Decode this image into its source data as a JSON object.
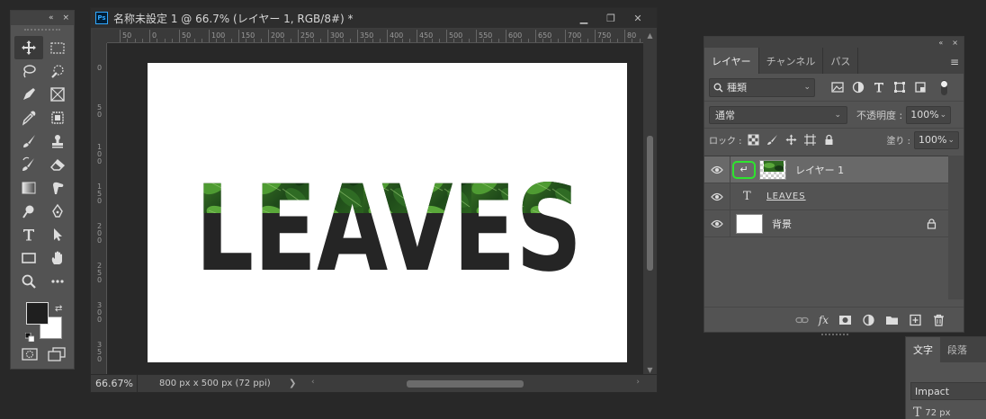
{
  "tools_panel": {
    "collapse": "«",
    "close": "×",
    "tools": [
      {
        "name": "move-tool-icon"
      },
      {
        "name": "marquee-tool-icon"
      },
      {
        "name": "lasso-tool-icon"
      },
      {
        "name": "quick-select-tool-icon"
      },
      {
        "name": "pen-tool-icon"
      },
      {
        "name": "frame-tool-icon"
      },
      {
        "name": "eyedropper-tool-icon"
      },
      {
        "name": "patch-tool-icon"
      },
      {
        "name": "brush-tool-icon"
      },
      {
        "name": "stamp-tool-icon"
      },
      {
        "name": "history-brush-tool-icon"
      },
      {
        "name": "eraser-tool-icon"
      },
      {
        "name": "gradient-tool-icon"
      },
      {
        "name": "smudge-tool-icon"
      },
      {
        "name": "dodge-tool-icon"
      },
      {
        "name": "pen-path-tool-icon"
      },
      {
        "name": "type-tool-icon"
      },
      {
        "name": "path-select-tool-icon"
      },
      {
        "name": "rectangle-tool-icon"
      },
      {
        "name": "hand-tool-icon"
      },
      {
        "name": "zoom-tool-icon"
      },
      {
        "name": "more-tools-icon"
      }
    ],
    "colors": {
      "foreground": "#1f1f1f",
      "background": "#ffffff"
    }
  },
  "document": {
    "ps_badge": "Ps",
    "title": "名称未設定 1 @ 66.7% (レイヤー 1, RGB/8#) *",
    "window_buttons": {
      "minimize": "▁",
      "maximize": "❐",
      "close": "✕"
    },
    "ruler_top_labels": [
      "50",
      "0",
      "50",
      "100",
      "150",
      "200",
      "250",
      "300",
      "350",
      "400",
      "450",
      "500",
      "550",
      "600",
      "650",
      "700",
      "750",
      "80"
    ],
    "ruler_left_labels": [
      "0",
      "5 0",
      "1 0 0",
      "1 5 0",
      "2 0 0",
      "2 5 0",
      "3 0 0",
      "3 5 0"
    ],
    "canvas_text": "LEAVES",
    "status": {
      "zoom": "66.67%",
      "doc_size": "800 px x 500 px (72 ppi)",
      "arrow": "❯"
    }
  },
  "layers_panel": {
    "collapse": "«",
    "close": "×",
    "tabs": [
      "レイヤー",
      "チャンネル",
      "パス"
    ],
    "active_tab": 0,
    "menu_icon": "≡",
    "kind_label": "種類",
    "kind_search_icon": "🔍",
    "blend_mode": "通常",
    "opacity_label": "不透明度 :",
    "opacity_value": "100%",
    "lock_label": "ロック :",
    "fill_label": "塗り :",
    "fill_value": "100%",
    "layers": [
      {
        "name": "レイヤー 1",
        "selected": true,
        "clip_arrow": "↵"
      },
      {
        "name": "LEAVES",
        "type_icon": "T"
      },
      {
        "name": "背景"
      }
    ]
  },
  "character_panel": {
    "tabs": [
      "文字",
      "段落"
    ],
    "font": "Impact",
    "size": "72 px",
    "size_icon": "T"
  }
}
